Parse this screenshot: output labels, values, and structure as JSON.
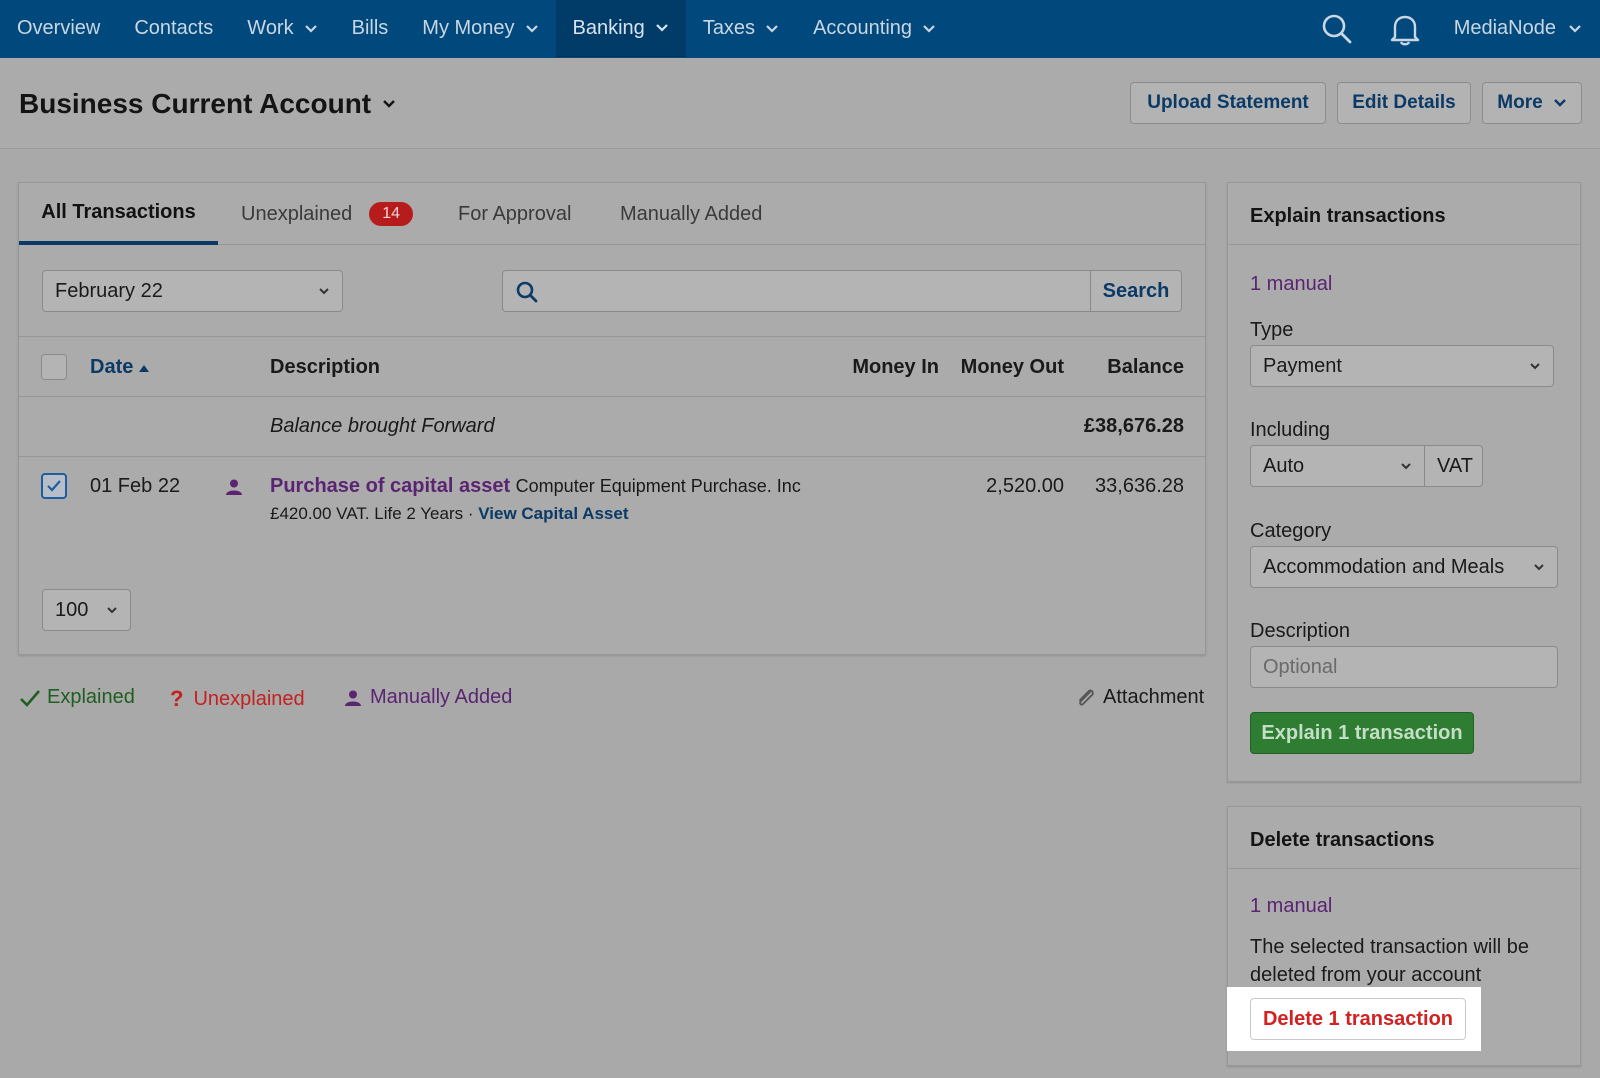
{
  "nav": {
    "items": [
      {
        "label": "Overview",
        "dropdown": false
      },
      {
        "label": "Contacts",
        "dropdown": false
      },
      {
        "label": "Work",
        "dropdown": true
      },
      {
        "label": "Bills",
        "dropdown": false
      },
      {
        "label": "My Money",
        "dropdown": true
      },
      {
        "label": "Banking",
        "dropdown": true,
        "active": true
      },
      {
        "label": "Taxes",
        "dropdown": true
      },
      {
        "label": "Accounting",
        "dropdown": true
      }
    ],
    "user": "MediaNode"
  },
  "header": {
    "title": "Business Current Account",
    "buttons": {
      "upload": "Upload Statement",
      "edit": "Edit Details",
      "more": "More"
    }
  },
  "tabs": {
    "all": "All Transactions",
    "unexplained": "Unexplained",
    "unexplained_count": "14",
    "approval": "For Approval",
    "manual": "Manually Added"
  },
  "filters": {
    "period": "February 22",
    "search_button": "Search",
    "search_value": ""
  },
  "table": {
    "headers": {
      "date": "Date",
      "description": "Description",
      "money_in": "Money In",
      "money_out": "Money Out",
      "balance": "Balance"
    },
    "brought_forward": {
      "label": "Balance brought Forward",
      "balance": "£38,676.28"
    },
    "rows": [
      {
        "date": "01 Feb 22",
        "selected": true,
        "title": "Purchase of capital asset",
        "contact": "Computer Equipment Purchase. Inc",
        "details": "£420.00 VAT. Life 2 Years ·",
        "link": "View Capital Asset",
        "money_in": "",
        "money_out": "2,520.00",
        "balance": "33,636.28"
      }
    ],
    "per_page": "100"
  },
  "legend": {
    "explained": "Explained",
    "unexplained": "Unexplained",
    "manual": "Manually Added",
    "attachment": "Attachment"
  },
  "explain": {
    "title": "Explain transactions",
    "count": "1 manual",
    "type_label": "Type",
    "type_value": "Payment",
    "including_label": "Including",
    "including_value": "Auto",
    "vat": "VAT",
    "category_label": "Category",
    "category_value": "Accommodation and Meals",
    "description_label": "Description",
    "description_placeholder": "Optional",
    "button": "Explain 1 transaction"
  },
  "delete": {
    "title": "Delete transactions",
    "count": "1 manual",
    "message_line1": "The selected transaction will be",
    "message_line2": "deleted from your account",
    "button": "Delete 1 transaction"
  },
  "colors": {
    "nav_bg": "#01497c",
    "link": "#0b3a66",
    "manual": "#5a2472",
    "explained": "#2e7d32",
    "danger": "#d32020"
  }
}
